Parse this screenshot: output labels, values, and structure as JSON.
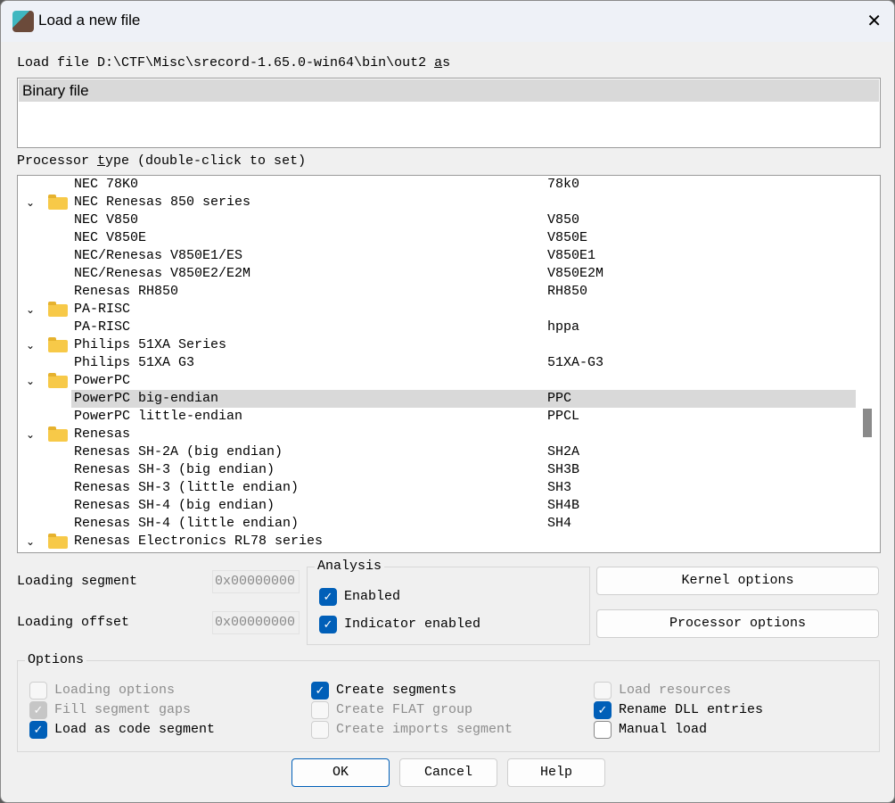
{
  "window": {
    "title": "Load a new file"
  },
  "load_label": {
    "prefix": "Load file D:\\CTF\\Misc\\srecord-1.65.0-win64\\bin\\out2 ",
    "accel": "a",
    "suffix": "s"
  },
  "format_list": {
    "selected": "Binary file"
  },
  "processor": {
    "label_pre": "Processor ",
    "label_accel": "t",
    "label_post": "ype (double-click to set)",
    "rows": [
      {
        "kind": "item",
        "name": "NEC 78K0",
        "code": "78k0"
      },
      {
        "kind": "folder",
        "name": "NEC Renesas 850 series"
      },
      {
        "kind": "item",
        "name": "NEC V850",
        "code": "V850"
      },
      {
        "kind": "item",
        "name": "NEC V850E",
        "code": "V850E"
      },
      {
        "kind": "item",
        "name": "NEC/Renesas V850E1/ES",
        "code": "V850E1"
      },
      {
        "kind": "item",
        "name": "NEC/Renesas V850E2/E2M",
        "code": "V850E2M"
      },
      {
        "kind": "item",
        "name": "Renesas RH850",
        "code": "RH850"
      },
      {
        "kind": "folder",
        "name": "PA-RISC"
      },
      {
        "kind": "item",
        "name": "PA-RISC",
        "code": "hppa"
      },
      {
        "kind": "folder",
        "name": "Philips 51XA Series"
      },
      {
        "kind": "item",
        "name": "Philips 51XA G3",
        "code": "51XA-G3"
      },
      {
        "kind": "folder",
        "name": "PowerPC"
      },
      {
        "kind": "item",
        "name": "PowerPC big-endian",
        "code": "PPC",
        "selected": true
      },
      {
        "kind": "item",
        "name": "PowerPC little-endian",
        "code": "PPCL"
      },
      {
        "kind": "folder",
        "name": "Renesas"
      },
      {
        "kind": "item",
        "name": "Renesas SH-2A (big endian)",
        "code": "SH2A"
      },
      {
        "kind": "item",
        "name": "Renesas SH-3 (big endian)",
        "code": "SH3B"
      },
      {
        "kind": "item",
        "name": "Renesas SH-3 (little endian)",
        "code": "SH3"
      },
      {
        "kind": "item",
        "name": "Renesas SH-4 (big endian)",
        "code": "SH4B"
      },
      {
        "kind": "item",
        "name": "Renesas SH-4 (little endian)",
        "code": "SH4"
      },
      {
        "kind": "folder",
        "name": "Renesas Electronics RL78 series"
      }
    ],
    "scroll_position": 0.67
  },
  "loading_segment": {
    "label": "Loading segment",
    "value": "0x00000000"
  },
  "loading_offset": {
    "label": "Loading offset",
    "value": "0x00000000"
  },
  "analysis": {
    "title": "Analysis",
    "enabled": {
      "label": "Enabled",
      "checked": true
    },
    "indicator": {
      "label": "Indicator enabled",
      "checked": true
    }
  },
  "buttons": {
    "kernel": "Kernel options",
    "processor": "Processor options",
    "ok": "OK",
    "cancel": "Cancel",
    "help": "Help"
  },
  "options": {
    "title": "Options",
    "items": [
      {
        "label": "Loading options",
        "checked": false,
        "disabled": true
      },
      {
        "label": "Fill segment gaps",
        "checked": true,
        "disabled": true
      },
      {
        "label": "Load as code segment",
        "checked": true,
        "disabled": false
      },
      {
        "label": "Create segments",
        "checked": true,
        "disabled": false
      },
      {
        "label": "Create FLAT group",
        "checked": false,
        "disabled": true
      },
      {
        "label": "Create imports segment",
        "checked": false,
        "disabled": true
      },
      {
        "label": "Load resources",
        "checked": false,
        "disabled": true
      },
      {
        "label": "Rename DLL entries",
        "checked": true,
        "disabled": false
      },
      {
        "label": "Manual load",
        "checked": false,
        "disabled": false
      }
    ]
  }
}
